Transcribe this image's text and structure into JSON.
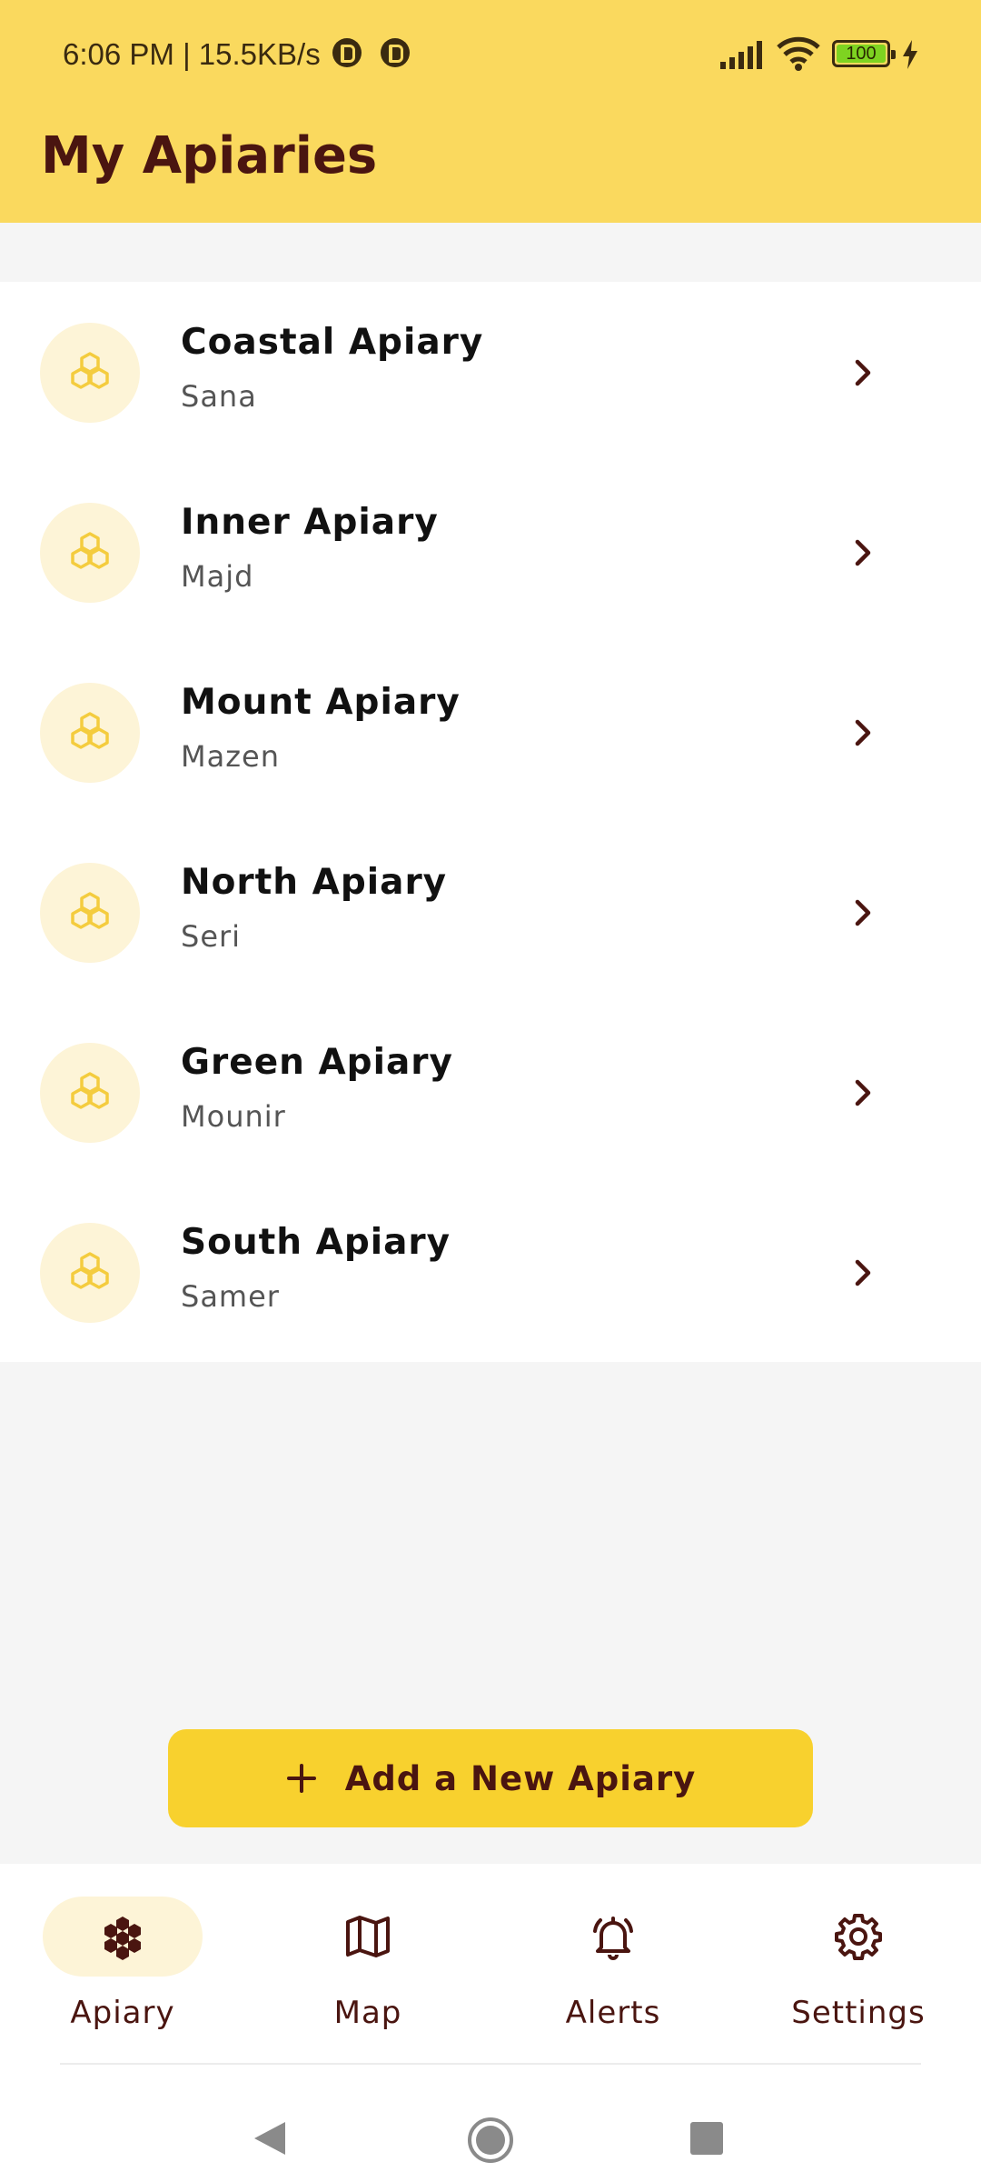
{
  "status_bar": {
    "time_speed": "6:06 PM | 15.5KB/s",
    "battery": "100",
    "icons": [
      "p-app-icon",
      "p-app-icon",
      "signal-icon",
      "wifi-icon",
      "battery-icon",
      "charging-icon"
    ]
  },
  "header": {
    "title": "My Apiaries",
    "background": "#fad95e",
    "title_color": "#4a1510"
  },
  "apiaries": [
    {
      "name": "Coastal Apiary",
      "owner": "Sana"
    },
    {
      "name": "Inner Apiary",
      "owner": "Majd"
    },
    {
      "name": "Mount Apiary",
      "owner": "Mazen"
    },
    {
      "name": "North Apiary",
      "owner": "Seri"
    },
    {
      "name": "Green Apiary",
      "owner": "Mounir"
    },
    {
      "name": "South Apiary",
      "owner": "Samer"
    }
  ],
  "add_button": {
    "label": "Add a New Apiary",
    "icon": "plus-icon",
    "background": "#f8d12e"
  },
  "bottom_nav": {
    "items": [
      {
        "label": "Apiary",
        "icon": "honeycomb-icon",
        "active": true
      },
      {
        "label": "Map",
        "icon": "map-icon",
        "active": false
      },
      {
        "label": "Alerts",
        "icon": "bell-icon",
        "active": false
      },
      {
        "label": "Settings",
        "icon": "gear-icon",
        "active": false
      }
    ]
  },
  "system_nav": [
    "back-icon",
    "home-icon",
    "recents-icon"
  ],
  "colors": {
    "accent": "#f8d12e",
    "dark_brown": "#4a1510",
    "icon_yellow": "#f4cc3e",
    "avatar_bg": "#fdf4d7"
  }
}
